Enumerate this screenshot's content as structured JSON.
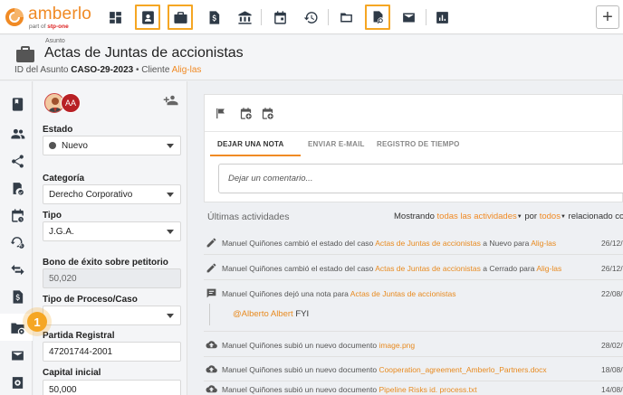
{
  "app": {
    "logo_text": "amberlo",
    "logo_sub_prefix": "part of",
    "logo_sub_brand": "stp-one"
  },
  "topbar": {
    "icons": [
      {
        "name": "dashboard-icon",
        "highlighted": false
      },
      {
        "name": "contacts-icon",
        "highlighted": true
      },
      {
        "name": "cases-icon",
        "highlighted": true
      },
      {
        "name": "billing-icon",
        "highlighted": false
      },
      {
        "name": "bank-icon",
        "highlighted": false
      },
      {
        "name": "calendar-icon",
        "highlighted": false
      },
      {
        "name": "time-tracking-icon",
        "highlighted": false
      },
      {
        "name": "folder-icon",
        "highlighted": false
      },
      {
        "name": "document-search-icon",
        "highlighted": true
      },
      {
        "name": "mail-icon",
        "highlighted": false
      },
      {
        "name": "reports-icon",
        "highlighted": false
      }
    ],
    "add_label": "+"
  },
  "header": {
    "kicker": "Asunto",
    "title": "Actas de Juntas de accionistas",
    "id_label": "ID del Asunto",
    "id_value": "CASO-29-2023",
    "client_label": "Cliente",
    "client_value": "Alig-las"
  },
  "rail": {
    "items": [
      "book-icon",
      "people-icon",
      "share-icon",
      "task-check-icon",
      "calendar-event-icon",
      "billing-time-icon",
      "transfer-icon",
      "invoice-icon",
      "folder-settings-icon",
      "mail-icon",
      "settings-icon"
    ],
    "active_index": 8,
    "badge": "1"
  },
  "form": {
    "avatar_initials": "AA",
    "fields": {
      "estado": {
        "label": "Estado",
        "value": "Nuevo"
      },
      "categoria": {
        "label": "Categoría",
        "value": "Derecho Corporativo"
      },
      "tipo": {
        "label": "Tipo",
        "value": "J.G.A."
      },
      "bono": {
        "label": "Bono de éxito sobre petitorio",
        "value": "50,020"
      },
      "tipo_proceso": {
        "label": "Tipo de Proceso/Caso",
        "value": ""
      },
      "partida": {
        "label": "Partida Registral",
        "value": "47201744-2001"
      },
      "capital": {
        "label": "Capital inicial",
        "value": "50,000"
      }
    }
  },
  "main": {
    "tabs": [
      "DEJAR UNA NOTA",
      "ENVIAR E-MAIL",
      "REGISTRO DE TIEMPO"
    ],
    "comment_placeholder": "Dejar un comentario...",
    "activities_title": "Últimas actividades",
    "filter": {
      "prefix": "Mostrando",
      "scope": "todas las actividades",
      "by": "por",
      "who": "todos",
      "related": "relacionado con"
    },
    "activities": [
      {
        "icon": "pencil-icon",
        "pre": "Manuel Quiñones cambió el estado del caso",
        "link": "Actas de Juntas de accionistas",
        "post": "a Nuevo para",
        "link2": "Alig-las",
        "date": "26/12/"
      },
      {
        "icon": "pencil-icon",
        "pre": "Manuel Quiñones cambió el estado del caso",
        "link": "Actas de Juntas de accionistas",
        "post": "a Cerrado para",
        "link2": "Alig-las",
        "date": "26/12/"
      },
      {
        "icon": "comment-icon",
        "pre": "Manuel Quiñones dejó una nota para",
        "link": "Actas de Juntas de accionistas",
        "post": "",
        "link2": "",
        "date": "22/08/"
      },
      {
        "icon": "upload-cloud-icon",
        "pre": "Manuel Quiñones subió un nuevo documento",
        "link": "image.png",
        "post": "",
        "link2": "",
        "date": "28/02/"
      },
      {
        "icon": "upload-cloud-icon",
        "pre": "Manuel Quiñones subió un nuevo documento",
        "link": "Cooperation_agreement_Amberlo_Partners.docx",
        "post": "",
        "link2": "",
        "date": "18/08/"
      },
      {
        "icon": "upload-cloud-icon",
        "pre": "Manuel Quiñones subió un nuevo documento",
        "link": "Pipeline Risks id. process.txt",
        "post": "",
        "link2": "",
        "date": "14/08/"
      }
    ],
    "note": {
      "mention": "@Alberto Albert",
      "text": "FYI"
    }
  }
}
